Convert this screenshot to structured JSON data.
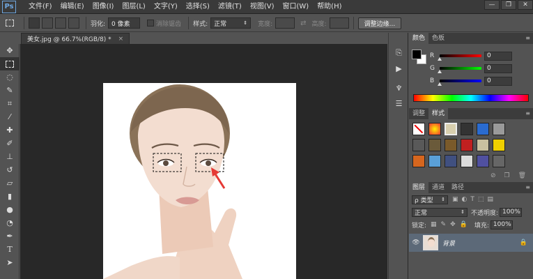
{
  "app": {
    "logo": "Ps"
  },
  "menu": [
    "文件(F)",
    "编辑(E)",
    "图像(I)",
    "图层(L)",
    "文字(Y)",
    "选择(S)",
    "滤镜(T)",
    "视图(V)",
    "窗口(W)",
    "帮助(H)"
  ],
  "window_controls": {
    "minimize": "—",
    "restore": "❐",
    "close": "✕"
  },
  "options": {
    "feather_label": "羽化:",
    "feather_value": "0 像素",
    "antialias_label": "消除锯齿",
    "style_label": "样式:",
    "style_value": "正常",
    "width_label": "宽度:",
    "height_label": "高度:",
    "refine_edge_label": "调整边缘..."
  },
  "document": {
    "tab_title": "美女.jpg @ 66.7%(RGB/8) *",
    "close": "×"
  },
  "color_panel": {
    "tabs": [
      "颜色",
      "色板"
    ],
    "channels": [
      {
        "label": "R",
        "value": "0",
        "gradient": "#ff0000"
      },
      {
        "label": "G",
        "value": "0",
        "gradient": "#00ff00"
      },
      {
        "label": "B",
        "value": "0",
        "gradient": "#0000ff"
      }
    ]
  },
  "styles_panel": {
    "tabs": [
      "调整",
      "样式"
    ]
  },
  "layers_panel": {
    "tabs": [
      "图层",
      "通道",
      "路径"
    ],
    "filter_label": "ρ 类型",
    "blend_mode": "正常",
    "opacity_label": "不透明度:",
    "opacity_value": "100%",
    "lock_label": "锁定:",
    "fill_label": "填充:",
    "fill_value": "100%",
    "layers": [
      {
        "name": "背景"
      }
    ]
  },
  "colors": {
    "accent": "#5c6978",
    "selection_arrow": "#e53935"
  }
}
